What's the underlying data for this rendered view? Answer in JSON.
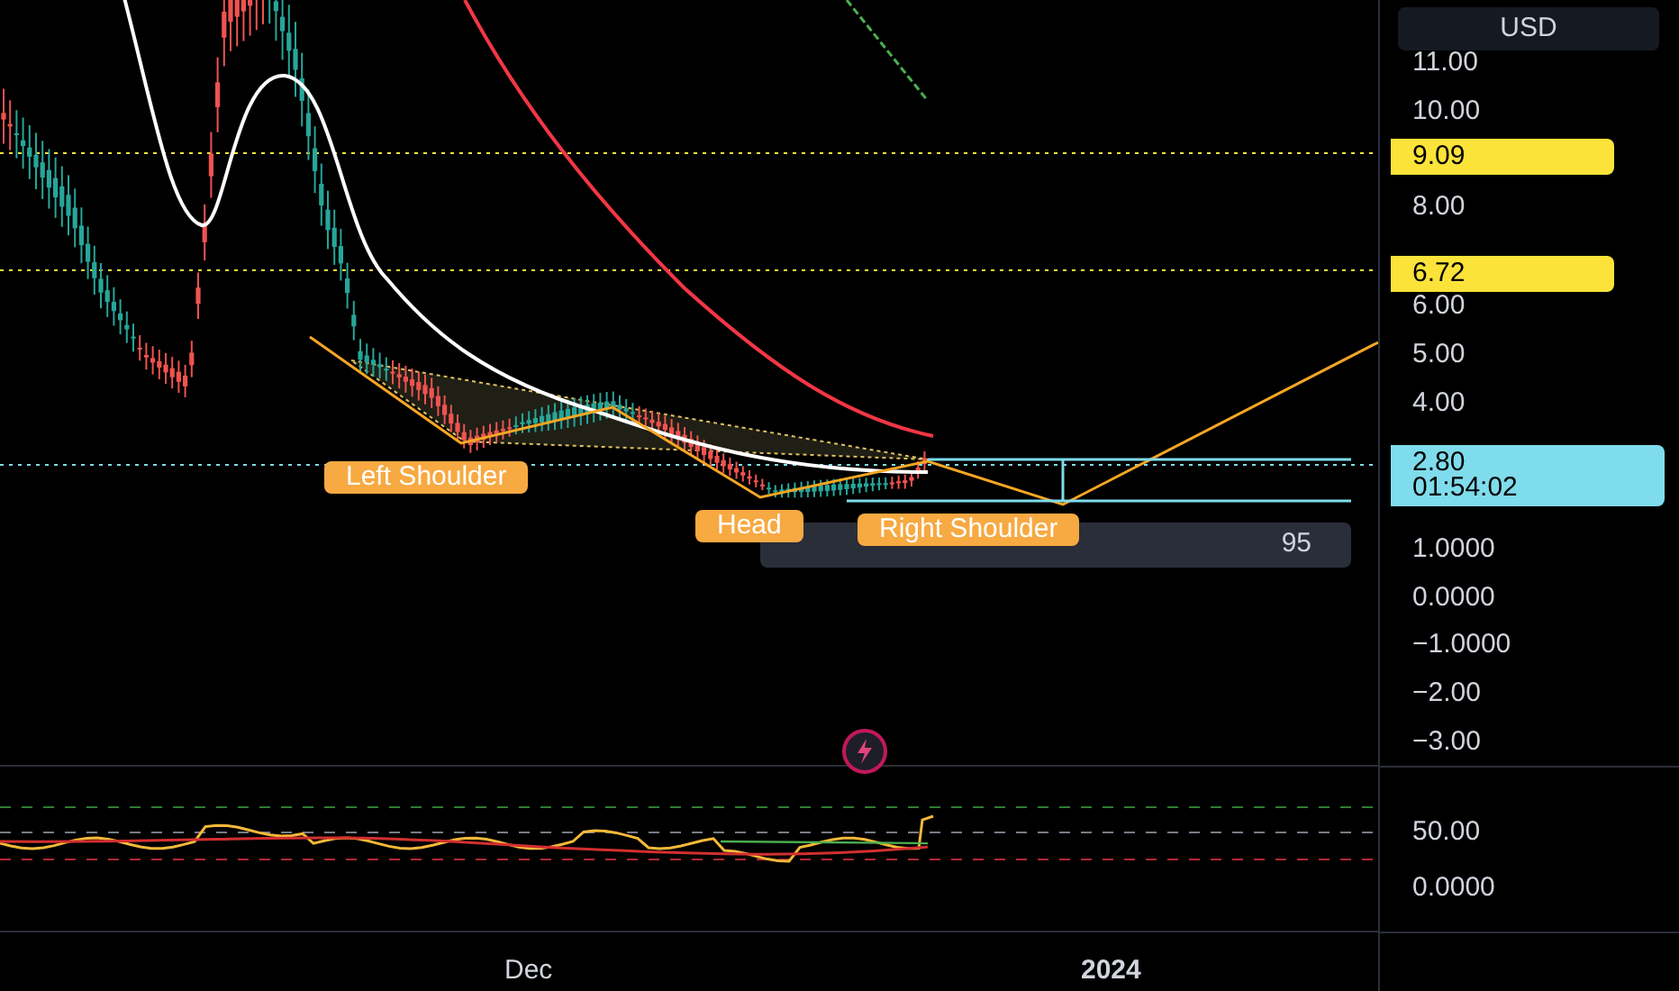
{
  "currency_button": "USD",
  "price_axis": {
    "ticks": [
      "11.00",
      "10.00",
      "8.00",
      "6.00",
      "5.00",
      "4.00",
      "1.0000",
      "0.0000",
      "−1.0000",
      "−2.00",
      "−3.00"
    ]
  },
  "price_tags": [
    {
      "kind": "alert",
      "text": "9.09"
    },
    {
      "kind": "alert",
      "text": "6.72"
    },
    {
      "kind": "last",
      "text": "2.80",
      "countdown": "01:54:02"
    }
  ],
  "pattern_labels": [
    "Left Shoulder",
    "Head",
    "Right Shoulder"
  ],
  "measure_box": {
    "text": "95"
  },
  "oscillator_axis": {
    "ticks": [
      "50.00",
      "0.0000"
    ]
  },
  "time_axis": [
    "Dec",
    "2024"
  ]
}
